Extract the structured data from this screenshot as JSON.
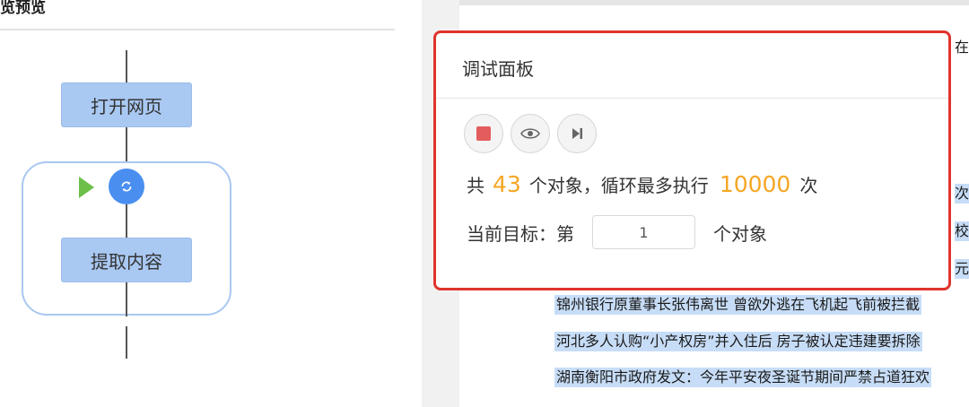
{
  "left": {
    "title": "览预览",
    "nodes": {
      "open_page": "打开网页",
      "extract": "提取内容"
    }
  },
  "page": {
    "lines": [
      "锦州银行原董事长张伟离世 曾欲外逃在飞机起飞前被拦截",
      "河北多人认购“小产权房”并入住后 房子被认定违建要拆除",
      "湖南衡阳市政府发文：今年平安夜圣诞节期间严禁占道狂欢"
    ],
    "edge_glyphs": [
      "在",
      "次",
      "校",
      "元"
    ]
  },
  "debug": {
    "title": "调试面板",
    "count_prefix": "共",
    "object_count": "43",
    "count_middle": "个对象，循环最多执行",
    "max_loops": "10000",
    "count_suffix": "次",
    "target_prefix": "当前目标：第",
    "target_value": "1",
    "target_suffix": "个对象",
    "controls": [
      "stop-icon",
      "eye-icon",
      "step-forward-icon"
    ],
    "colors": {
      "highlight_number": "#f5a623",
      "panel_border": "#e0342c",
      "stop": "#e35d5d"
    }
  }
}
